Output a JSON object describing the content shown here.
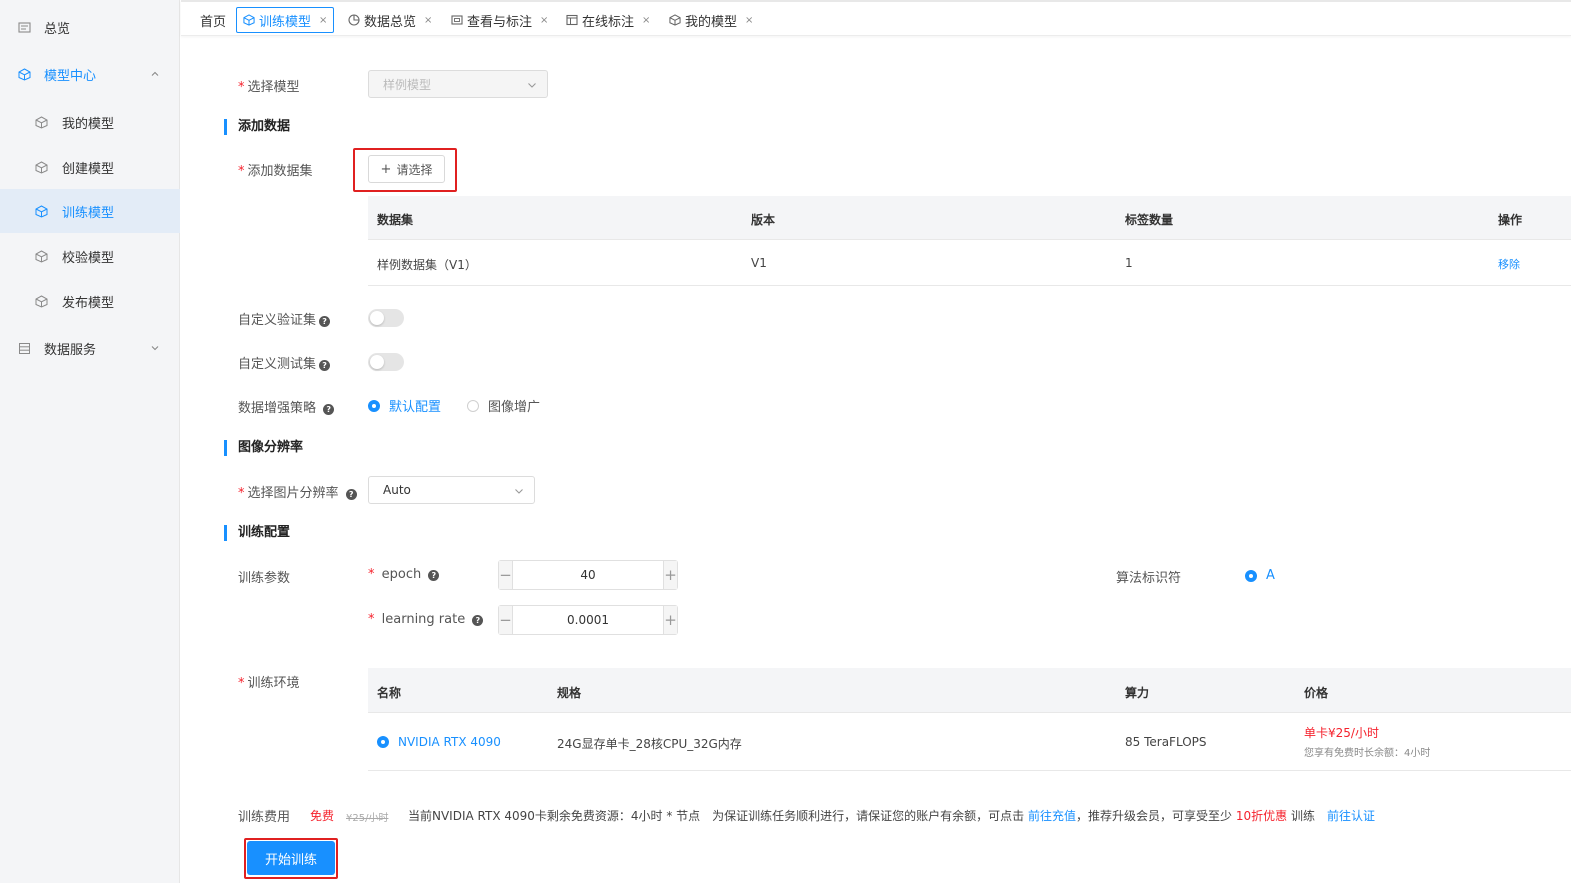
{
  "colors": {
    "accent": "#1890ff",
    "danger": "#f5222d",
    "sidebar_bg": "#f4f5f7"
  },
  "sidebar": {
    "overview": "总览",
    "model_center": "模型中心",
    "my_models": "我的模型",
    "create_model": "创建模型",
    "train_model": "训练模型",
    "validate_model": "校验模型",
    "publish_model": "发布模型",
    "data_service": "数据服务"
  },
  "tabs": {
    "home": "首页",
    "train_model": "训练模型",
    "data_overview": "数据总览",
    "view_annotate": "查看与标注",
    "online_annotate": "在线标注",
    "my_models": "我的模型",
    "close": "×"
  },
  "form": {
    "required_mark": "*",
    "select_model_label": "选择模型",
    "select_model_placeholder": "样例模型",
    "add_data_section": "添加数据",
    "add_dataset_label": "添加数据集",
    "choose_button": "请选择",
    "dataset_table": {
      "headers": {
        "dataset": "数据集",
        "version": "版本",
        "tag_count": "标签数量",
        "action": "操作"
      },
      "row": {
        "dataset": "样例数据集（V1）",
        "version": "V1",
        "tag_count": "1",
        "action": "移除"
      }
    },
    "custom_validation_label": "自定义验证集",
    "custom_test_label": "自定义测试集",
    "augment_label": "数据增强策略",
    "augment_default": "默认配置",
    "augment_image": "图像增广",
    "resolution_section": "图像分辨率",
    "resolution_label": "选择图片分辨率",
    "resolution_value": "Auto",
    "train_config_section": "训练配置",
    "train_params_label": "训练参数",
    "epoch_label": "epoch",
    "epoch_value": "40",
    "lr_label": "learning rate",
    "lr_value": "0.0001",
    "algo_label": "算法标识符",
    "algo_value": "A",
    "env_label": "训练环境",
    "env_table": {
      "headers": {
        "name": "名称",
        "spec": "规格",
        "compute": "算力",
        "price": "价格"
      },
      "row": {
        "name": "NVIDIA RTX 4090",
        "spec": "24G显存单卡_28核CPU_32G内存",
        "compute": "85 TeraFLOPS",
        "price": "单卡¥25/小时",
        "free_remaining": "您享有免费时长余额：4小时"
      }
    },
    "fee": {
      "label": "训练费用",
      "free": "免费",
      "original": "¥25/小时",
      "notice1": "当前NVIDIA RTX 4090卡剩余免费资源：4小时 * 节点　为保证训练任务顺利进行，请保证您的账户有余额，可点击",
      "recharge": "前往充值",
      "notice2": "，推荐升级会员，可享受至少",
      "discount": "10折优惠",
      "notice3": "训练",
      "verify": "前往认证"
    },
    "start_button": "开始训练"
  }
}
